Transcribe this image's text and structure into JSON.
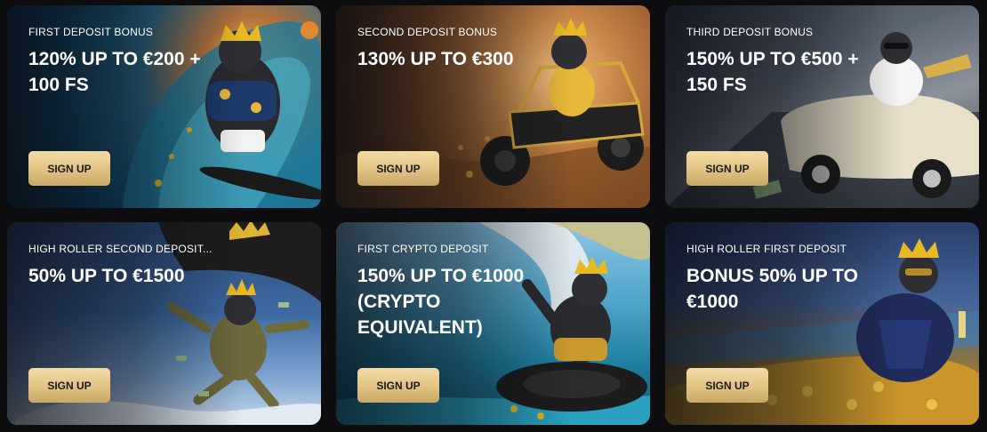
{
  "colors": {
    "page_background": "#0d0d0f",
    "button_gold": "#e0c283",
    "button_text": "#1a1a1a",
    "text": "#ffffff"
  },
  "cards": [
    {
      "label": "FIRST DEPOSIT BONUS",
      "headline": "120% UP TO €200 + 100 FS",
      "button": "SIGN UP",
      "art": "gorilla-surfing-wave-illustration"
    },
    {
      "label": "SECOND DEPOSIT BONUS",
      "headline": "130% UP TO €300",
      "button": "SIGN UP",
      "art": "gorilla-driving-buggy-illustration"
    },
    {
      "label": "THIRD DEPOSIT BONUS",
      "headline": "150% UP TO €500 + 150 FS",
      "button": "SIGN UP",
      "art": "gorilla-driving-convertible-illustration"
    },
    {
      "label": "HIGH ROLLER SECOND DEPOSIT...",
      "headline": "50% UP TO €1500",
      "button": "SIGN UP",
      "art": "gorilla-parachuting-illustration"
    },
    {
      "label": "FIRST CRYPTO DEPOSIT",
      "headline": "150% UP TO €1000 (CRYPTO EQUIVALENT)",
      "button": "SIGN UP",
      "art": "gorilla-waterslide-illustration"
    },
    {
      "label": "HIGH ROLLER FIRST DEPOSIT",
      "headline": "BONUS 50% UP TO €1000",
      "button": "SIGN UP",
      "art": "gorilla-gold-coins-illustration"
    }
  ]
}
